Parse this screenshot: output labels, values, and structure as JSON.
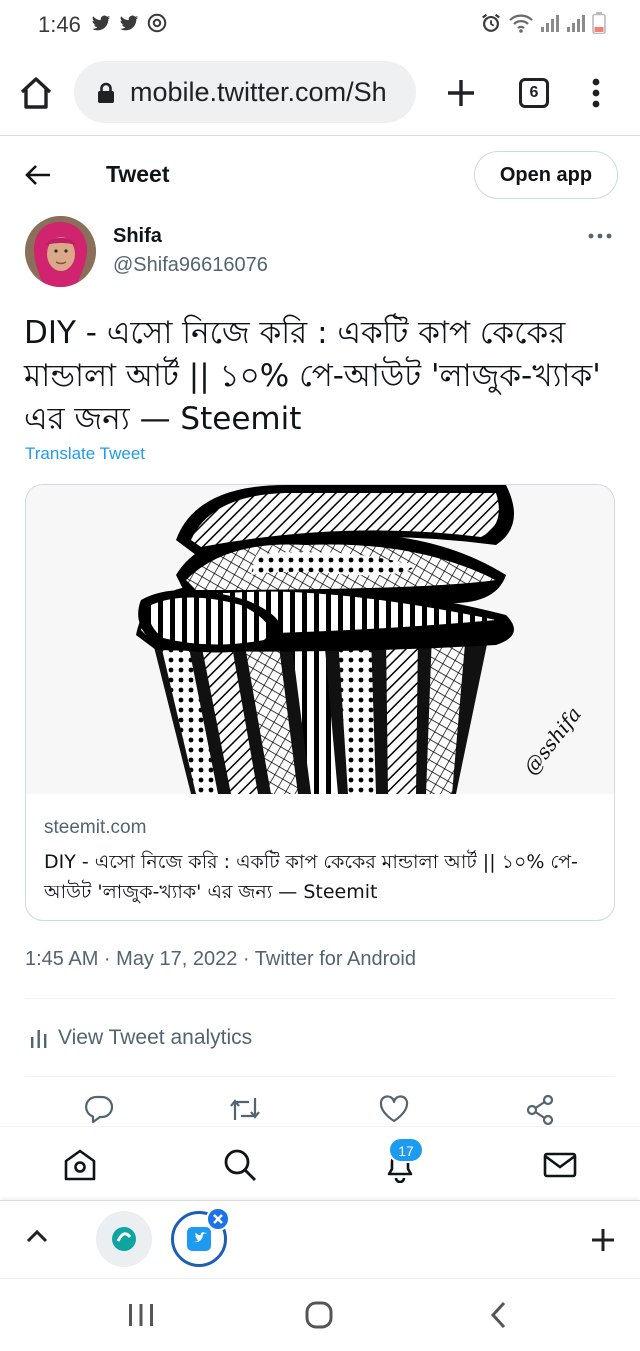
{
  "status_bar": {
    "time": "1:46",
    "left_icons": [
      "twitter-icon",
      "twitter-icon",
      "messenger-icon"
    ],
    "right_icons": [
      "alarm-icon",
      "wifi-icon",
      "signal-icon",
      "signal-icon",
      "battery-low-icon"
    ]
  },
  "browser": {
    "url": "mobile.twitter.com/Sh",
    "tab_count": "6"
  },
  "header": {
    "title": "Tweet",
    "open_app": "Open app"
  },
  "tweet": {
    "author_name": "Shifa",
    "author_handle": "@Shifa96616076",
    "text": "DIY - এসো নিজে করি : একটি কাপ কেকের মান্ডালা আর্ট || ১০% পে-আউট 'লাজুক-খ্যাক' এর জন্য — Steemit",
    "translate": "Translate Tweet",
    "card": {
      "image_signature": "@sshifa",
      "domain": "steemit.com",
      "title": "DIY - এসো নিজে করি : একটি কাপ কেকের মান্ডালা আর্ট || ১০% পে-আউট 'লাজুক-খ্যাক' এর জন্য — Steemit"
    },
    "timestamp": "1:45 AM · May 17, 2022 · Twitter for Android",
    "analytics": "View Tweet analytics"
  },
  "twitter_nav": {
    "notifications_count": "17"
  },
  "colors": {
    "accent": "#1d9bf0",
    "text_primary": "#0f1419",
    "text_secondary": "#536471",
    "border": "#cfd9de"
  }
}
